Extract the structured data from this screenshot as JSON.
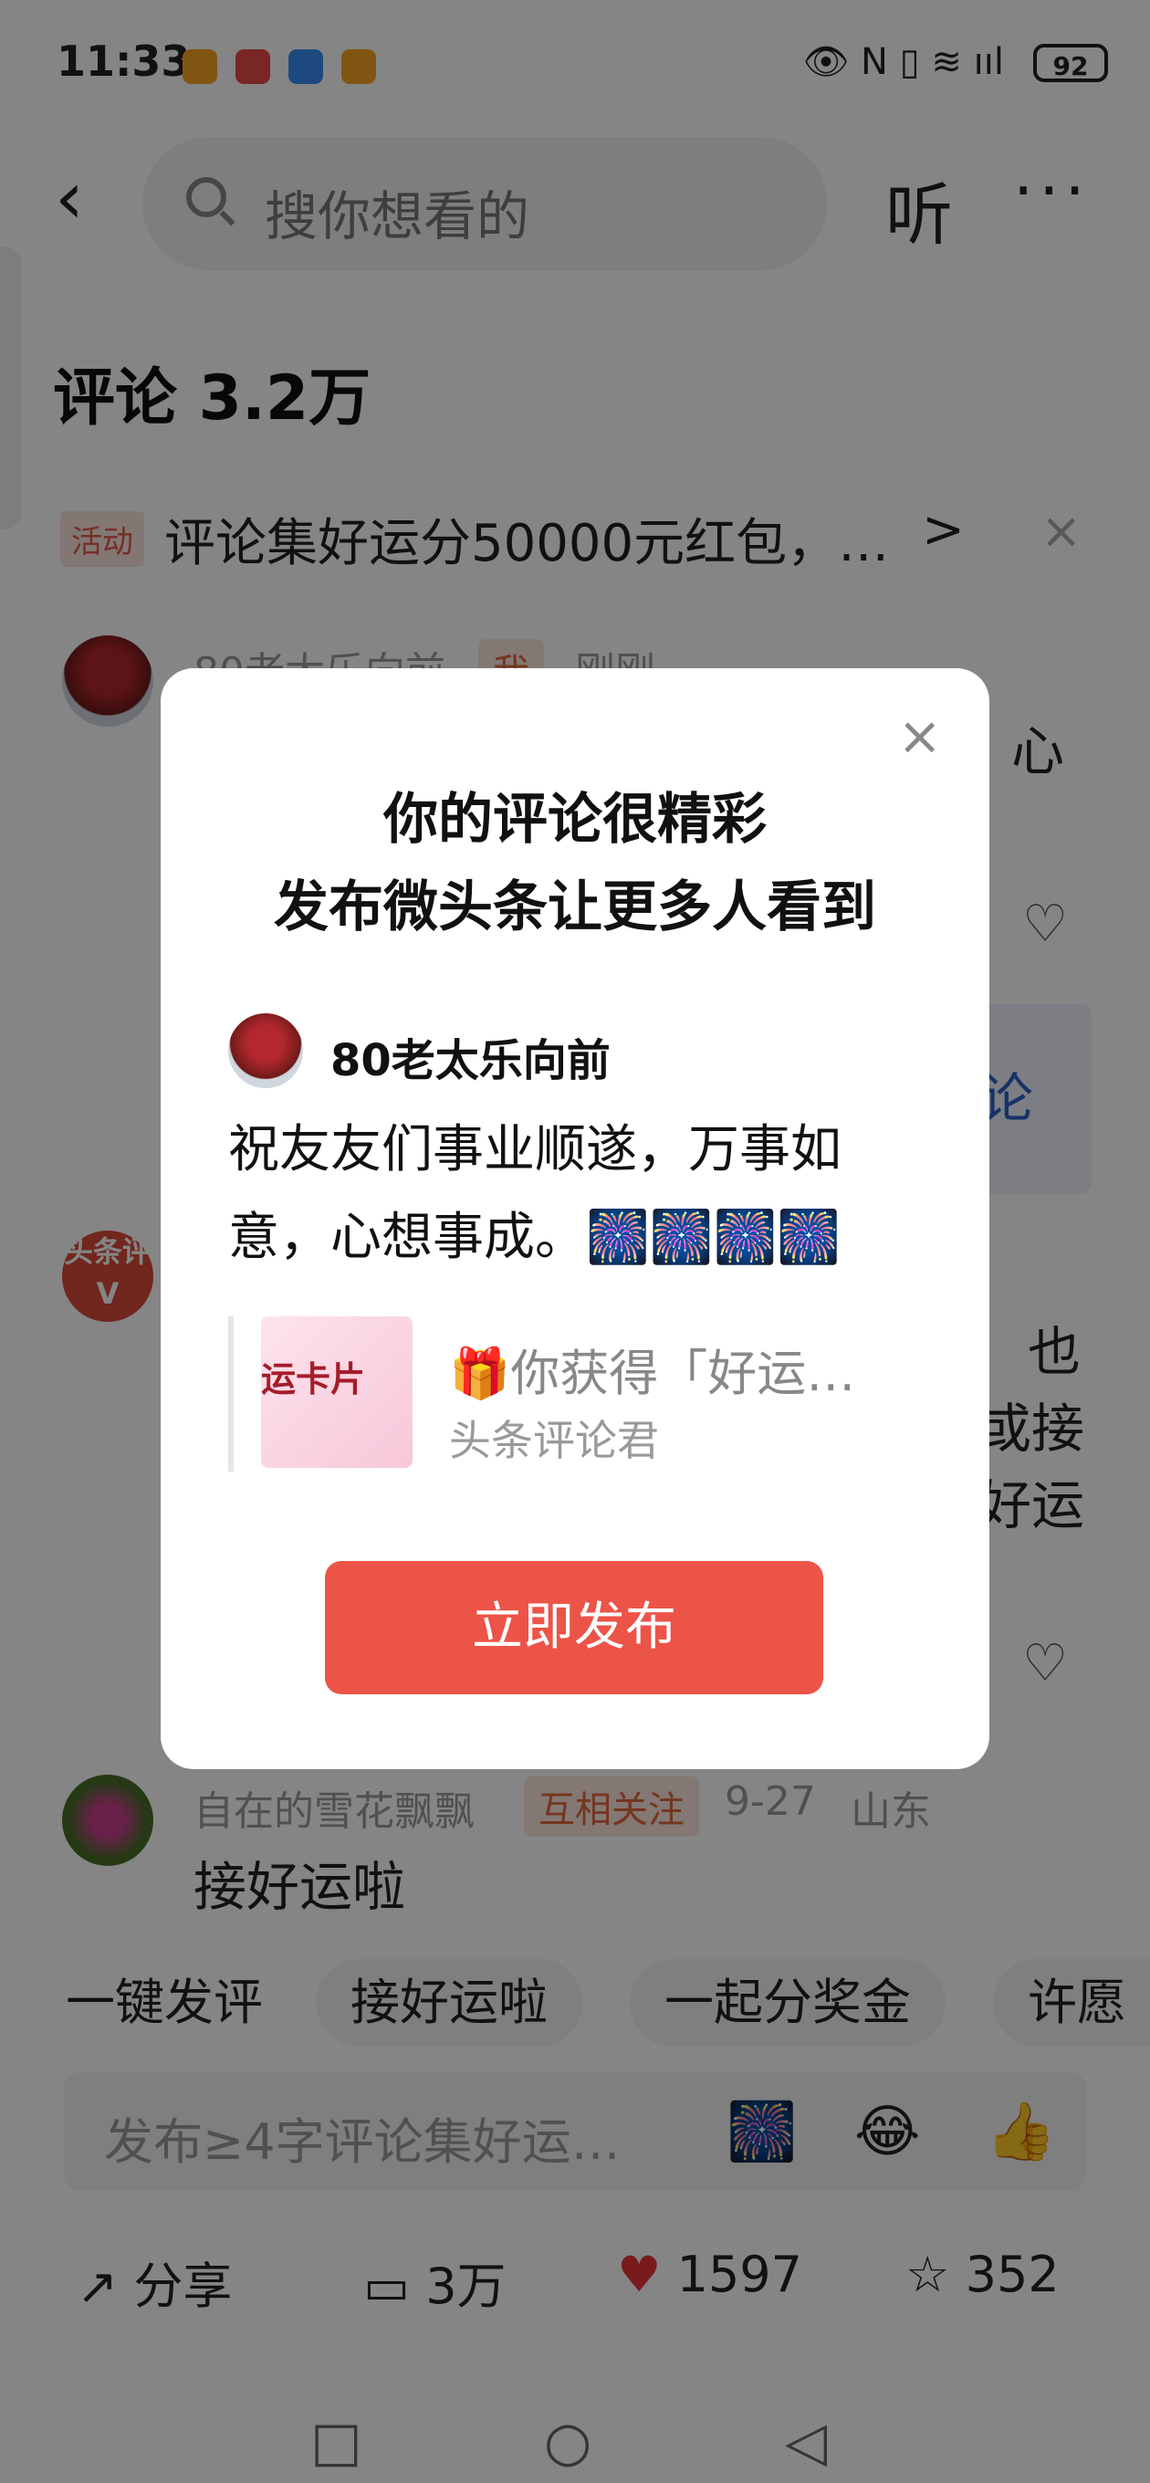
{
  "status_bar": {
    "time": "11:33",
    "battery": "92",
    "app_colors": [
      "#f5a623",
      "#e84a4a",
      "#3b8cf5",
      "#f5a623"
    ]
  },
  "top_bar": {
    "search_placeholder": "搜你想看的",
    "listen_label": "听",
    "more_label": "···"
  },
  "comments_header": {
    "title": "评论 3.2万"
  },
  "promo": {
    "tag": "活动",
    "text": "评论集好运分50000元红包，…",
    "arrow": ">",
    "close": "×"
  },
  "background_comments": [
    {
      "name": "80老太乐向前",
      "tag": "我",
      "time": "刚刚",
      "partial_text": "心",
      "partial_text_2": "论"
    },
    {
      "badge": "头条评V",
      "partial_lines": [
        "也",
        "或接",
        "好运"
      ]
    },
    {
      "name": "自在的雪花飘飘",
      "tag": "互相关注",
      "date": "9-27",
      "location": "山东",
      "text": "接好运啦"
    }
  ],
  "quick_chips": [
    "一键发评",
    "接好运啦",
    "一起分奖金",
    "许愿"
  ],
  "input": {
    "placeholder": "发布≥4字评论集好运…"
  },
  "bottom_bar": {
    "share": "分享",
    "comments": "3万",
    "likes": "1597",
    "favorites": "352"
  },
  "dialog": {
    "title_line1": "你的评论很精彩",
    "title_line2": "发布微头条让更多人看到",
    "author": "80老太乐向前",
    "body": "祝友友们事业顺遂，万事如意，心想事成。",
    "card_label": "运卡片",
    "quote_title": "🎁你获得「好运…",
    "quote_source": "头条评论君",
    "publish_button": "立即发布",
    "close": "×",
    "accent_color": "#ec5448"
  }
}
